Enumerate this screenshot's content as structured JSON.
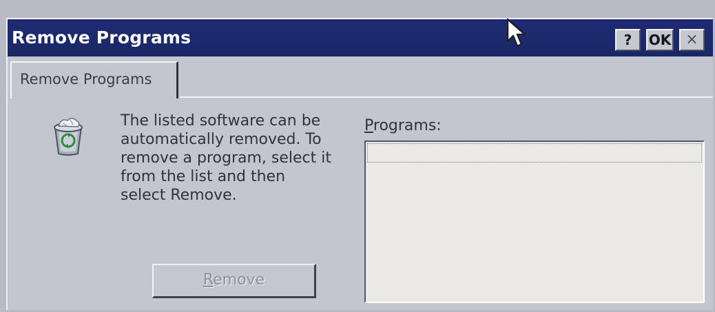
{
  "window": {
    "title": "Remove Programs",
    "buttons": {
      "help": "?",
      "ok": "OK",
      "close": "×"
    }
  },
  "tabs": [
    {
      "label": "Remove Programs",
      "selected": true
    }
  ],
  "description": {
    "lines": [
      "The listed software can be",
      "automatically removed. To",
      "remove a program, select it",
      "from the list and then",
      "select Remove."
    ]
  },
  "programs": {
    "label_mnemonic": "P",
    "label_rest": "rograms:",
    "items": []
  },
  "remove_button": {
    "mnemonic": "R",
    "rest": "emove",
    "enabled": false
  },
  "icons": {
    "app_icon": "recycle-bin-icon",
    "cursor": "mouse-pointer-icon"
  },
  "colors": {
    "titlebar": "#1e2b73",
    "window": "#c3c5cf",
    "listbox": "#ebe9e6"
  }
}
